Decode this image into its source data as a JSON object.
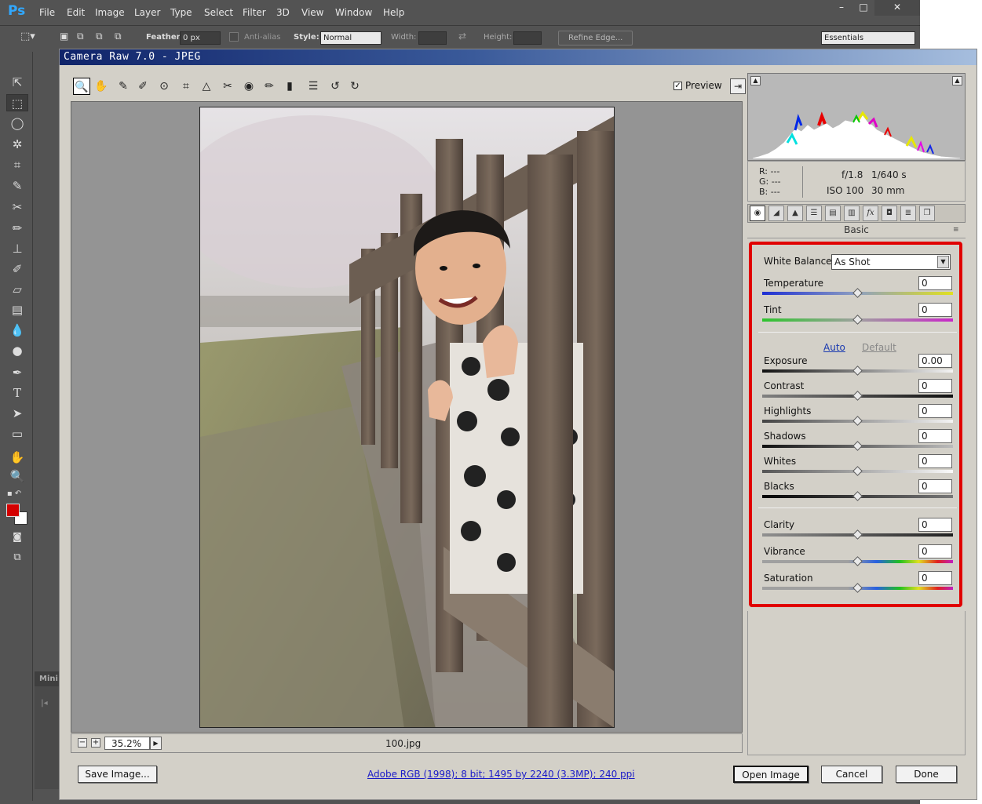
{
  "app": {
    "logo": "Ps",
    "menus": [
      "File",
      "Edit",
      "Image",
      "Layer",
      "Type",
      "Select",
      "Filter",
      "3D",
      "View",
      "Window",
      "Help"
    ],
    "window_buttons": {
      "minimize": "–",
      "maximize": "□",
      "close": "✕"
    }
  },
  "options_bar": {
    "feather_label": "Feather:",
    "feather_value": "0 px",
    "antialias_label": "Anti-alias",
    "style_label": "Style:",
    "style_value": "Normal",
    "width_label": "Width:",
    "height_label": "Height:",
    "refine_edge": "Refine Edge...",
    "workspace": "Essentials"
  },
  "minibridge_label": "Mini",
  "dialog": {
    "title": "Camera Raw 7.0  -  JPEG",
    "preview_label": "Preview",
    "preview_checked": true,
    "zoom_value": "35.2%",
    "file_name": "100.jpg",
    "histogram": {
      "r_label": "R:",
      "g_label": "G:",
      "b_label": "B:",
      "r_value": "---",
      "g_value": "---",
      "b_value": "---",
      "aperture": "f/1.8",
      "shutter": "1/640 s",
      "iso": "ISO 100",
      "focal": "30 mm"
    },
    "panel_title": "Basic",
    "basic": {
      "white_balance_label": "White Balance:",
      "white_balance_value": "As Shot",
      "temperature_label": "Temperature",
      "temperature_value": "0",
      "tint_label": "Tint",
      "tint_value": "0",
      "auto_label": "Auto",
      "default_label": "Default",
      "exposure_label": "Exposure",
      "exposure_value": "0.00",
      "contrast_label": "Contrast",
      "contrast_value": "0",
      "highlights_label": "Highlights",
      "highlights_value": "0",
      "shadows_label": "Shadows",
      "shadows_value": "0",
      "whites_label": "Whites",
      "whites_value": "0",
      "blacks_label": "Blacks",
      "blacks_value": "0",
      "clarity_label": "Clarity",
      "clarity_value": "0",
      "vibrance_label": "Vibrance",
      "vibrance_value": "0",
      "saturation_label": "Saturation",
      "saturation_value": "0",
      "slider_position": 0.5
    },
    "buttons": {
      "save_image": "Save Image...",
      "workflow_link": "Adobe RGB (1998); 8 bit; 1495 by 2240 (3.3MP); 240 ppi",
      "open_image": "Open Image",
      "cancel": "Cancel",
      "done": "Done"
    }
  },
  "colors": {
    "highlight_border": "#e00000",
    "foreground_swatch": "#d40000",
    "background_swatch": "#ffffff"
  }
}
